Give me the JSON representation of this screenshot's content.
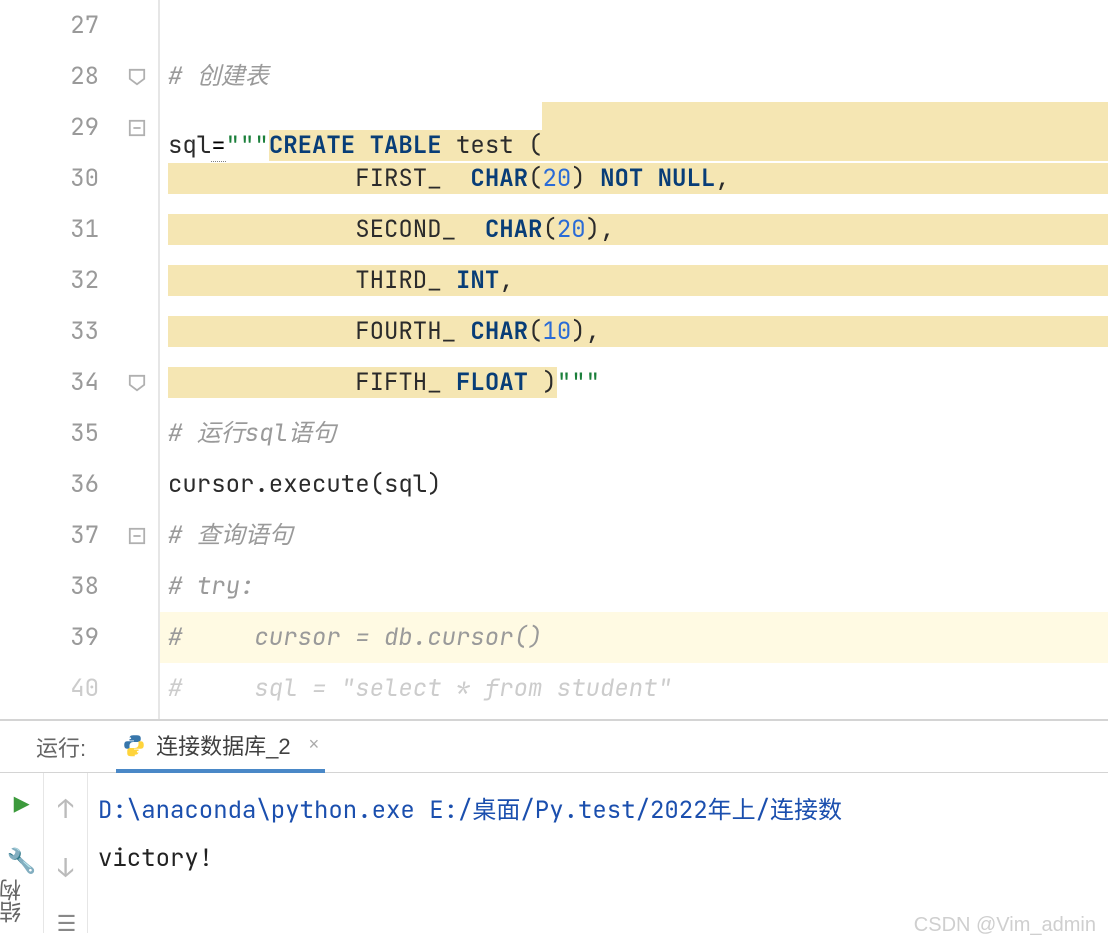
{
  "gutter": {
    "lines": [
      "27",
      "28",
      "29",
      "30",
      "31",
      "32",
      "33",
      "34",
      "35",
      "36",
      "37",
      "38",
      "39",
      "40"
    ]
  },
  "code": {
    "l28_comment_prefix": "# ",
    "l28_comment_text": "创建表",
    "l29_assign": "sql",
    "l29_eq": "=",
    "l29_triple": "\"\"\"",
    "l29_kw_create": "CREATE TABLE",
    "l29_ident": " test ",
    "l29_paren": "(",
    "l30_field": "FIRST_",
    "l30_type": "CHAR",
    "l30_num": "20",
    "l30_notnull": "NOT NULL",
    "l31_field": "SECOND_",
    "l31_type": "CHAR",
    "l31_num": "20",
    "l32_field": "THIRD_",
    "l32_type": "INT",
    "l33_field": "FOURTH_",
    "l33_type": "CHAR",
    "l33_num": "10",
    "l34_field": "FIFTH_",
    "l34_type": "FLOAT",
    "l34_close": ")",
    "l34_triple": "\"\"\"",
    "l35_comment": "# 运行sql语句",
    "l36_code": "cursor.execute(sql)",
    "l37_comment": "# 查询语句",
    "l38_comment": "# try:",
    "l39_comment": "#     cursor = db.cursor()",
    "l40_comment": "#     sql = \"select * from student\""
  },
  "run": {
    "label": "运行:",
    "tab_name": "连接数据库_2",
    "tab_close": "×",
    "console_path": "D:\\anaconda\\python.exe E:/桌面/Py.test/2022年上/连接数",
    "console_out": "victory!"
  },
  "side_label": "结构",
  "watermark": "CSDN @Vim_admin"
}
